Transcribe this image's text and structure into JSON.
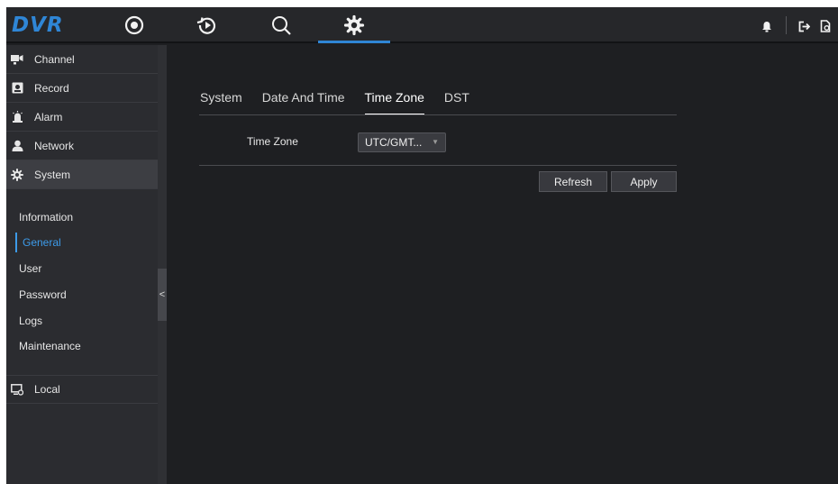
{
  "app": {
    "logo": "DVR"
  },
  "topnav": [
    {
      "name": "live-view",
      "icon": "target-icon"
    },
    {
      "name": "playback",
      "icon": "playback-icon"
    },
    {
      "name": "search",
      "icon": "search-icon"
    },
    {
      "name": "settings",
      "icon": "gear-icon",
      "active": true
    }
  ],
  "topright": {
    "icons": [
      "bell-icon",
      "logout-icon",
      "file-icon"
    ]
  },
  "sidebar": {
    "items": [
      {
        "label": "Channel",
        "icon": "camera-icon"
      },
      {
        "label": "Record",
        "icon": "record-icon"
      },
      {
        "label": "Alarm",
        "icon": "alarm-icon"
      },
      {
        "label": "Network",
        "icon": "network-icon"
      },
      {
        "label": "System",
        "icon": "gear-icon",
        "expanded": true
      },
      {
        "label": "Local",
        "icon": "local-icon"
      }
    ],
    "subitems": [
      {
        "label": "Information"
      },
      {
        "label": "General",
        "active": true
      },
      {
        "label": "User"
      },
      {
        "label": "Password"
      },
      {
        "label": "Logs"
      },
      {
        "label": "Maintenance"
      }
    ],
    "collapse_label": "<"
  },
  "tabs": [
    {
      "label": "System"
    },
    {
      "label": "Date And Time"
    },
    {
      "label": "Time Zone",
      "active": true
    },
    {
      "label": "DST"
    }
  ],
  "form": {
    "time_zone_label": "Time Zone",
    "time_zone_value": "UTC/GMT..."
  },
  "buttons": {
    "refresh": "Refresh",
    "apply": "Apply"
  },
  "colors": {
    "accent": "#2f86d6",
    "active_sub": "#3d9be9",
    "background": "#1e1f22",
    "sidebar": "#2b2c30"
  }
}
